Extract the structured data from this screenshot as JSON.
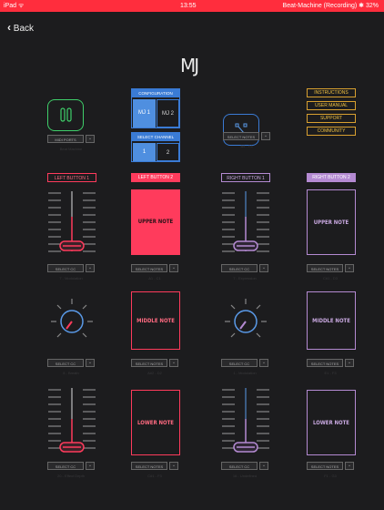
{
  "status": {
    "left": "iPad ᯤ",
    "time": "13:55",
    "right": "Beat-Machine (Recording)  ✱ 32%"
  },
  "nav": {
    "back": "Back"
  },
  "logo": "MJ",
  "top": {
    "midi_ports": "MIDI PORTS",
    "midi_sub": "Beat Machine",
    "config_title": "CONFIGURATION",
    "mj1": "MJ 1",
    "mj2": "MJ 2",
    "channel_title": "SELECT CHANNEL",
    "ch1": "1",
    "ch2": "2",
    "select_notes": "SELECT NOTES",
    "select_notes_sub": "B5 - F6",
    "links": [
      "INSTRUCTIONS",
      "USER MANUAL",
      "SUPPORT",
      "COMMUNITY"
    ]
  },
  "columns": [
    {
      "label": "LEFT BUTTON 1",
      "color": "#ff3b5c"
    },
    {
      "label": "LEFT BUTTON 2",
      "color": "#ff3b5c"
    },
    {
      "label": "RIGHT BUTTON 1",
      "color": "#b48ad2"
    },
    {
      "label": "RIGHT BUTTON 2",
      "color": "#b48ad2"
    }
  ],
  "pads": {
    "upper": "UPPER NOTE",
    "middle": "MIDDLE NOTE",
    "lower": "LOWER NOTE"
  },
  "controls": {
    "select_cc": "SELECT CC",
    "select_notes": "SELECT NOTES",
    "row1": [
      "7 - Modulation",
      "A1 - C1",
      "7 - Expression",
      "C#1 - D3"
    ],
    "row2": [
      "8 - Breath",
      "A#2 - D2",
      "1 - Modulation",
      "E1 - F3"
    ],
    "row3": [
      "20 - Effect Depth",
      "C#1 - F3",
      "16 - Undefined",
      "F1 - G3"
    ]
  },
  "colors": {
    "accent_red": "#ff3b5c",
    "accent_purple": "#b48ad2",
    "accent_blue": "#3a7bd5",
    "link_gold": "#f0c040",
    "green": "#3fcf6a"
  }
}
